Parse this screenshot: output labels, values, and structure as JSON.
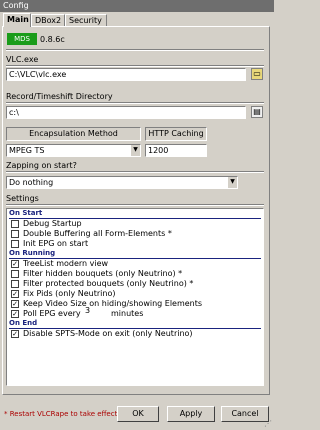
{
  "window": {
    "title": "Config"
  },
  "tabs": [
    {
      "label": "Main"
    },
    {
      "label": "DBox2"
    },
    {
      "label": "Security"
    }
  ],
  "main": {
    "version_badge": "MDS",
    "version": "0.8.6c",
    "vlc_exe": {
      "label": "VLC.exe",
      "value": "C:\\VLC\\vlc.exe"
    },
    "record_dir": {
      "label": "Record/Timeshift Directory",
      "value": "c:\\"
    },
    "encapsulation": {
      "header": "Encapsulation Method",
      "value": "MPEG TS"
    },
    "http_caching": {
      "header": "HTTP Caching",
      "value": "1200"
    },
    "zapping": {
      "label": "Zapping on start?",
      "value": "Do nothing"
    },
    "settings": {
      "label": "Settings"
    },
    "groups": [
      {
        "title": "On Start",
        "items": [
          {
            "label": "Debug Startup",
            "checked": false
          },
          {
            "label": "Double Buffering all Form-Elements *",
            "checked": false
          },
          {
            "label": "Init EPG on start",
            "checked": false
          }
        ]
      },
      {
        "title": "On Running",
        "items": [
          {
            "label": "TreeList modern view",
            "checked": true
          },
          {
            "label": "Filter hidden bouquets (only Neutrino) *",
            "checked": false
          },
          {
            "label": "Filter protected bouquets (only Neutrino) *",
            "checked": false
          },
          {
            "label": "Fix Pids (only Neutrino)",
            "checked": true
          },
          {
            "label": "Keep Video Size on hiding/showing Elements",
            "checked": true
          },
          {
            "label": "Poll EPG every",
            "checked": true,
            "value": "3",
            "suffix": "minutes"
          }
        ]
      },
      {
        "title": "On End",
        "items": [
          {
            "label": "Disable SPTS-Mode on exit (only Neutrino)",
            "checked": true
          }
        ]
      }
    ]
  },
  "footer": {
    "note": "* Restart VLCRape to take effect",
    "ok_label": "OK",
    "apply_label": "Apply",
    "cancel_label": "Cancel"
  }
}
